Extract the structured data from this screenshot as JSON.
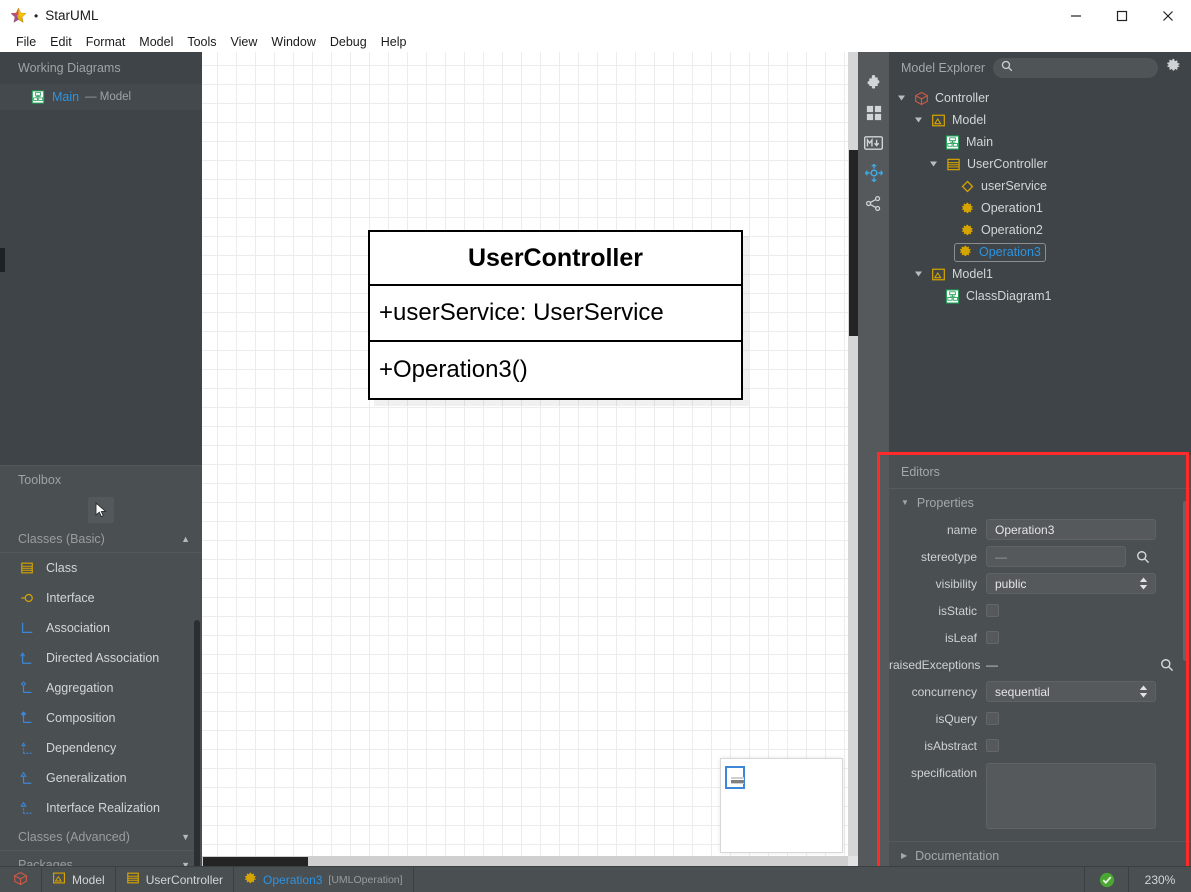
{
  "window": {
    "title": "StarUML",
    "bullet": "•",
    "app_icon": "star-icon",
    "controls": {
      "minimize": "minimize-icon",
      "maximize": "maximize-icon",
      "close": "close-icon"
    }
  },
  "menubar": {
    "items": [
      "File",
      "Edit",
      "Format",
      "Model",
      "Tools",
      "View",
      "Window",
      "Debug",
      "Help"
    ]
  },
  "working_diagrams": {
    "title": "Working Diagrams",
    "items": [
      {
        "icon": "class-diagram-icon",
        "label": "Main",
        "sub": "— Model"
      }
    ]
  },
  "toolbox": {
    "title": "Toolbox",
    "pointer_icon": "cursor-arrow-icon",
    "groups": [
      {
        "label": "Classes (Basic)",
        "expanded": true,
        "caret": "▲",
        "items": [
          {
            "icon": "class-icon",
            "label": "Class"
          },
          {
            "icon": "interface-icon",
            "label": "Interface"
          },
          {
            "icon": "association-icon",
            "label": "Association"
          },
          {
            "icon": "directed-association-icon",
            "label": "Directed Association"
          },
          {
            "icon": "aggregation-icon",
            "label": "Aggregation"
          },
          {
            "icon": "composition-icon",
            "label": "Composition"
          },
          {
            "icon": "dependency-icon",
            "label": "Dependency"
          },
          {
            "icon": "generalization-icon",
            "label": "Generalization"
          },
          {
            "icon": "interface-realization-icon",
            "label": "Interface Realization"
          }
        ]
      },
      {
        "label": "Classes (Advanced)",
        "expanded": false,
        "caret": "▼",
        "items": []
      },
      {
        "label": "Packages",
        "expanded": false,
        "caret": "▼",
        "items": []
      }
    ]
  },
  "canvas": {
    "class_box": {
      "name": "UserController",
      "attributes": [
        "+userService: UserService"
      ],
      "operations": [
        "+Operation3()"
      ]
    },
    "minimap": {
      "name": "diagram-minimap"
    }
  },
  "icon_rail": {
    "buttons": [
      {
        "icon": "puzzle-piece-icon",
        "active": false
      },
      {
        "icon": "grid-panels-icon",
        "active": false
      },
      {
        "icon": "markdown-icon",
        "active": false
      },
      {
        "icon": "move-target-icon",
        "active": true
      },
      {
        "icon": "share-nodes-icon",
        "active": false
      }
    ]
  },
  "model_explorer": {
    "title": "Model Explorer",
    "search_placeholder": "",
    "search_value": "",
    "search_icon": "search-icon",
    "settings_icon": "gear-icon",
    "tree": [
      {
        "depth": 0,
        "arrow": "down",
        "icon": "project-icon",
        "label": "Controller",
        "selected": false
      },
      {
        "depth": 1,
        "arrow": "down",
        "icon": "model-icon",
        "label": "Model",
        "selected": false
      },
      {
        "depth": 2,
        "arrow": "none",
        "icon": "class-diagram-icon",
        "label": "Main",
        "selected": false
      },
      {
        "depth": 2,
        "arrow": "down",
        "icon": "class-icon",
        "label": "UserController",
        "selected": false
      },
      {
        "depth": 3,
        "arrow": "none",
        "icon": "attribute-icon",
        "label": "userService",
        "selected": false
      },
      {
        "depth": 3,
        "arrow": "none",
        "icon": "operation-icon",
        "label": "Operation1",
        "selected": false
      },
      {
        "depth": 3,
        "arrow": "none",
        "icon": "operation-icon",
        "label": "Operation2",
        "selected": false
      },
      {
        "depth": 3,
        "arrow": "none",
        "icon": "operation-icon",
        "label": "Operation3",
        "selected": true
      },
      {
        "depth": 1,
        "arrow": "down",
        "icon": "model-icon",
        "label": "Model1",
        "selected": false
      },
      {
        "depth": 2,
        "arrow": "none",
        "icon": "class-diagram-icon",
        "label": "ClassDiagram1",
        "selected": false
      }
    ]
  },
  "editors": {
    "title": "Editors",
    "sections": [
      {
        "label": "Properties",
        "expanded": true,
        "tri": "▼"
      },
      {
        "label": "Documentation",
        "expanded": false,
        "tri": "▶"
      }
    ],
    "properties": [
      {
        "label": "name",
        "type": "text",
        "value": "Operation3"
      },
      {
        "label": "stereotype",
        "type": "search",
        "value": "—"
      },
      {
        "label": "visibility",
        "type": "select",
        "value": "public"
      },
      {
        "label": "isStatic",
        "type": "checkbox",
        "value": false
      },
      {
        "label": "isLeaf",
        "type": "checkbox",
        "value": false
      },
      {
        "label": "raisedExceptions",
        "type": "lookup",
        "value": "—"
      },
      {
        "label": "concurrency",
        "type": "select",
        "value": "sequential"
      },
      {
        "label": "isQuery",
        "type": "checkbox",
        "value": false
      },
      {
        "label": "isAbstract",
        "type": "checkbox",
        "value": false
      },
      {
        "label": "specification",
        "type": "textarea",
        "value": ""
      }
    ]
  },
  "statusbar": {
    "breadcrumb": [
      {
        "icon": "project-icon",
        "label": ""
      },
      {
        "icon": "model-icon",
        "label": "Model"
      },
      {
        "icon": "class-icon",
        "label": "UserController"
      },
      {
        "icon": "operation-icon",
        "label": "Operation3",
        "type": "[UMLOperation]"
      }
    ],
    "status_icon": "check-circle-icon",
    "zoom": "230%"
  },
  "colors": {
    "accent_blue": "#2f93e0",
    "annotation_red": "#ff2a2a",
    "panel_dark": "#3e4447",
    "panel_mid": "#4a4f52",
    "gold": "#d6a400",
    "green": "#2f9e52"
  }
}
